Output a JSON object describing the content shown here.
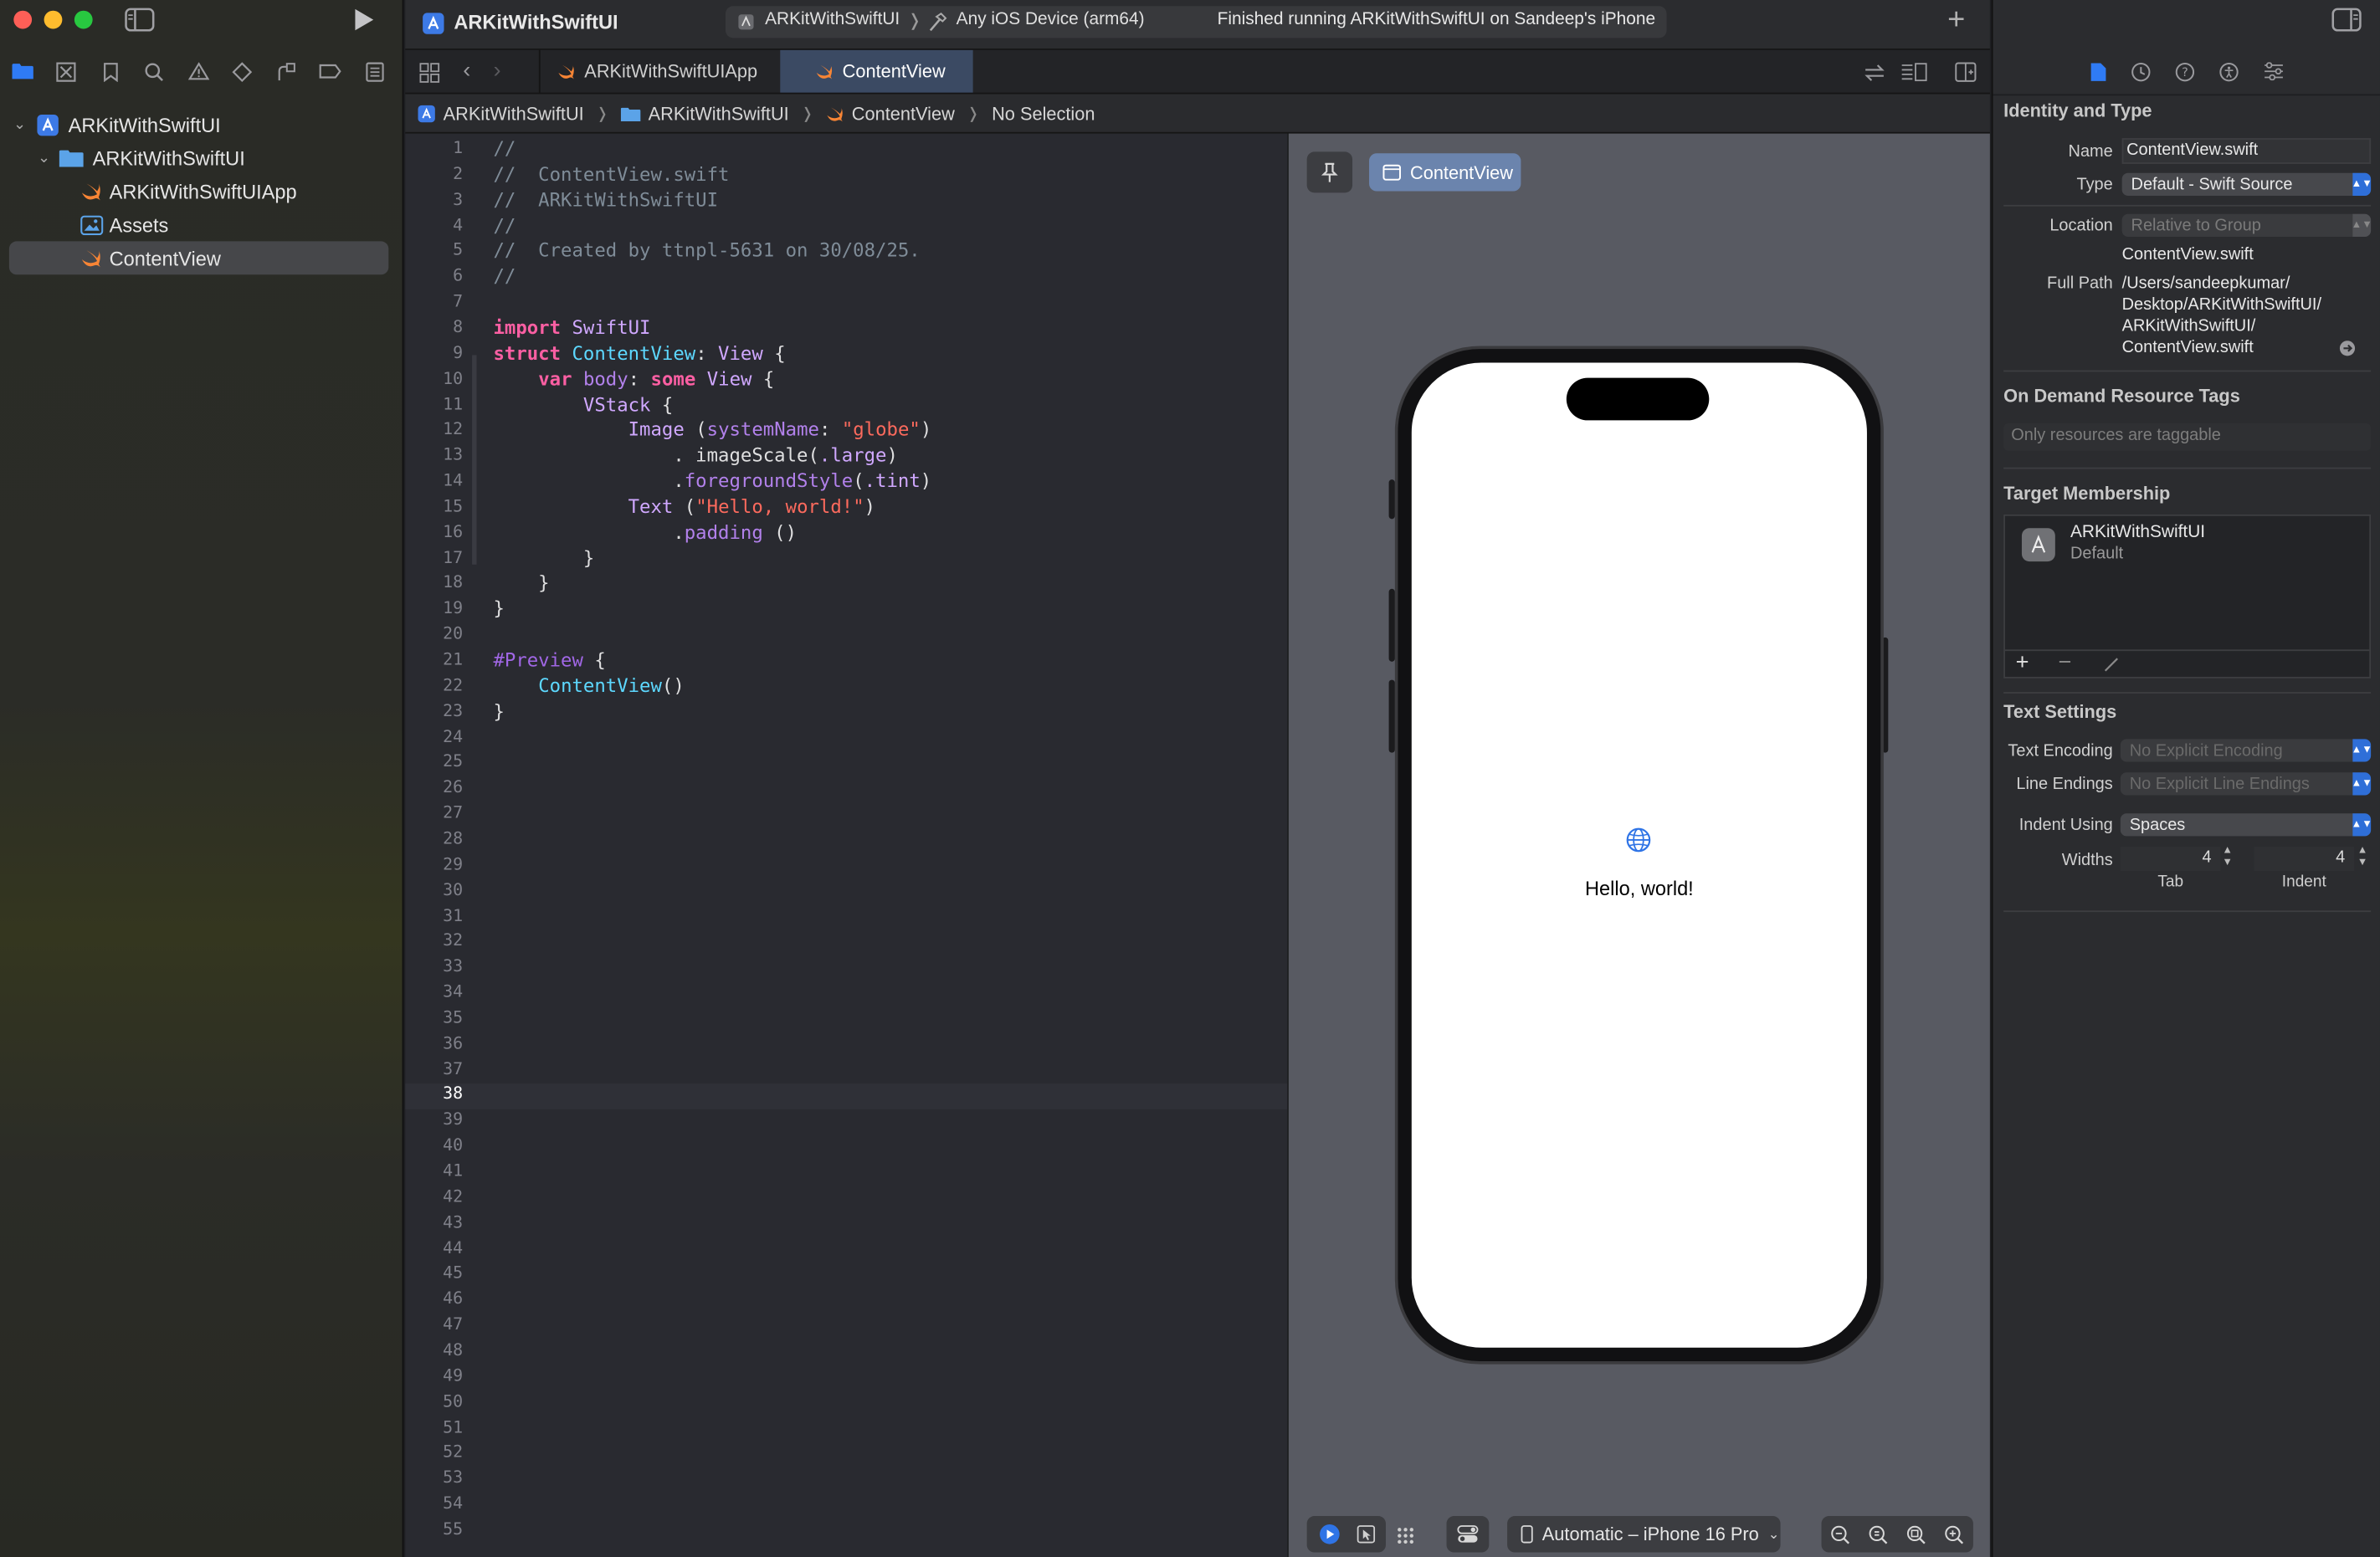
{
  "window": {
    "project": "ARKitWithSwiftUI"
  },
  "toolbar": {
    "project_title": "ARKitWithSwiftUI",
    "scheme": "ARKitWithSwiftUI",
    "destination": "Any iOS Device (arm64)",
    "status": "Finished running ARKitWithSwiftUI on Sandeep's iPhone"
  },
  "navigator": {
    "items": [
      {
        "label": "ARKitWithSwiftUI",
        "kind": "project"
      },
      {
        "label": "ARKitWithSwiftUI",
        "kind": "folder"
      },
      {
        "label": "ARKitWithSwiftUIApp",
        "kind": "swift"
      },
      {
        "label": "Assets",
        "kind": "assets"
      },
      {
        "label": "ContentView",
        "kind": "swift",
        "selected": true
      }
    ]
  },
  "tabs": [
    {
      "label": "ARKitWithSwiftUIApp",
      "active": false
    },
    {
      "label": "ContentView",
      "active": true
    }
  ],
  "breadcrumb": [
    "ARKitWithSwiftUI",
    "ARKitWithSwiftUI",
    "ContentView",
    "No Selection"
  ],
  "editor": {
    "current_line": 38,
    "line_count": 55,
    "lines": [
      "//",
      "//  ContentView.swift",
      "//  ARKitWithSwiftUI",
      "//",
      "//  Created by ttnpl-5631 on 30/08/25.",
      "//",
      "",
      "import SwiftUI",
      "struct ContentView: View {",
      "    var body: some View {",
      "        VStack {",
      "            Image (systemName: \"globe\")",
      "                . imageScale(.large)",
      "                .foregroundStyle(.tint)",
      "            Text (\"Hello, world!\")",
      "                .padding ()",
      "        }",
      "    }",
      "}",
      "",
      "#Preview {",
      "    ContentView()",
      "}"
    ]
  },
  "preview": {
    "pin_label": "",
    "chip_label": "ContentView",
    "hello_text": "Hello, world!",
    "device_label": "Automatic – iPhone 16 Pro"
  },
  "inspector": {
    "identity_header": "Identity and Type",
    "name_label": "Name",
    "name_value": "ContentView.swift",
    "type_label": "Type",
    "type_value": "Default - Swift Source",
    "location_label": "Location",
    "location_value": "Relative to Group",
    "location_file": "ContentView.swift",
    "fullpath_label": "Full Path",
    "fullpath_lines": [
      "/Users/sandeepkumar/",
      "Desktop/ARKitWithSwiftUI/",
      "ARKitWithSwiftUI/",
      "ContentView.swift"
    ],
    "odr_header": "On Demand Resource Tags",
    "odr_placeholder": "Only resources are taggable",
    "target_header": "Target Membership",
    "target_name": "ARKitWithSwiftUI",
    "target_sub": "Default",
    "text_header": "Text Settings",
    "encoding_label": "Text Encoding",
    "encoding_value": "No Explicit Encoding",
    "endings_label": "Line Endings",
    "endings_value": "No Explicit Line Endings",
    "indent_label": "Indent Using",
    "indent_value": "Spaces",
    "widths_label": "Widths",
    "tab_value": "4",
    "indent_width_value": "4",
    "tab_caption": "Tab",
    "indent_caption": "Indent"
  },
  "colors": {
    "accent": "#2f6fd8",
    "editor_bg": "#292a30",
    "canvas_bg": "#585a62"
  }
}
